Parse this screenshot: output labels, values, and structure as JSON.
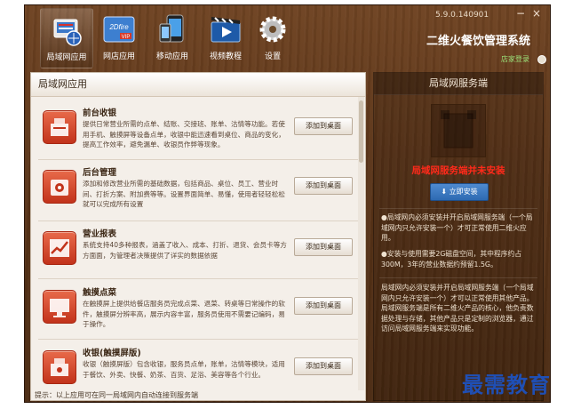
{
  "window": {
    "version": "5.9.0.140901",
    "title": "二维火餐饮管理系统",
    "store_login": "店家登录",
    "minimize_symbol": "−",
    "close_symbol": "×"
  },
  "nav": {
    "items": [
      {
        "label": "局域网应用",
        "icon": "lan-app-icon"
      },
      {
        "label": "网店应用",
        "icon": "2dfire-vip-icon"
      },
      {
        "label": "移动应用",
        "icon": "mobile-icon"
      },
      {
        "label": "视频教程",
        "icon": "video-icon"
      },
      {
        "label": "设置",
        "icon": "gear-icon"
      }
    ],
    "icon_labels": {
      "brand": "2Dfire",
      "vip": "VIP"
    }
  },
  "left_panel": {
    "header": "局域网应用",
    "add_button_label": "添加到桌面",
    "modules": [
      {
        "title": "前台收银",
        "desc": "提供日常营业所需的点单、结账、交接班、账单、沽情等功能。若使用手机、触摸屏等设备点单，收银中能迅速看到桌位、商品的变化，提高工作效率，避免漏单、收银员作弊等现象。",
        "icon": "cash-register-icon"
      },
      {
        "title": "后台管理",
        "desc": "添加和修改营业所需的基础数据，包括商品、桌位、员工、营业时间、打折方案、附加费等等。设置界面简单、易懂，使用者轻轻松松就可以完成所有设置",
        "icon": "gear-box-icon"
      },
      {
        "title": "营业报表",
        "desc": "系统支持40多种报表，涵盖了收入、成本、打折、退货、会员卡等方方面面，为管理者决策提供了详实的数据依据",
        "icon": "trend-chart-icon"
      },
      {
        "title": "触摸点菜",
        "desc": "在触摸屏上提供给餐店服务员完成点菜、退菜、转桌等日常操作的软件，触摸屏分辨率高，展示内容丰富，服务员使用不需要记编码，易于操作。",
        "icon": "touch-order-icon"
      },
      {
        "title": "收银(触摸屏版)",
        "desc": "收银（触摸屏版）包含收银，服务员点单，账单，沽情等模块，适用于餐饮、外卖、快餐、奶茶、百货、足浴、美容等各个行业。",
        "icon": "touch-cash-register-icon"
      }
    ],
    "tip": "提示：以上应用可在同一局域网内自动连接到服务端"
  },
  "right_panel": {
    "header": "局域网服务端",
    "warning": "局域网服务端并未安装",
    "install_label": "立即安装",
    "note1": "●局域网内必须安装并开启局域网服务端（一个局域网内只允许安装一个）才可正常使用二维火应用。",
    "note2": "●安装与使用需要2G磁盘空间，其中程序约占300M，3年的营业数据约预留1.5G。",
    "note3": "局域网内必须安装并开启局域网服务端（一个局域网内只允许安装一个）才可以正常使用其他产品。局域网服务端是所有二维火产品的核心，他负责数据处理与存储，其他产品只是定制的浏览器，通过访问局域网服务端来实现功能。"
  },
  "watermark": "最需教育",
  "colors": {
    "wood": "#5b3519",
    "module_icon": "#d04428",
    "warning": "#ff2a1a",
    "install": "#2d6ab2",
    "store_login": "#9be37a",
    "watermark": "#1f4fb5"
  }
}
